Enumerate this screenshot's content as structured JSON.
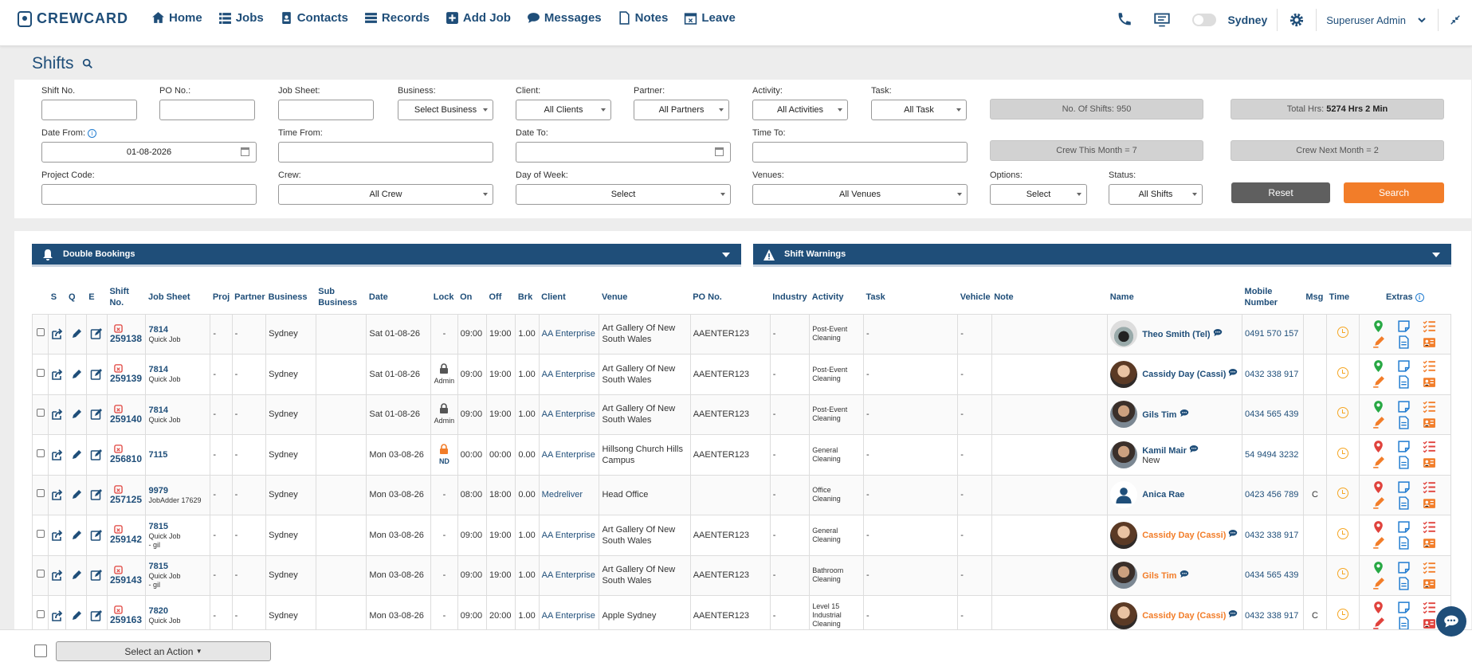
{
  "brand": {
    "name": "CREWCARD"
  },
  "nav": {
    "items": [
      {
        "label": "Home",
        "icon": "home-icon"
      },
      {
        "label": "Jobs",
        "icon": "list-icon"
      },
      {
        "label": "Contacts",
        "icon": "contact-icon"
      },
      {
        "label": "Records",
        "icon": "records-icon"
      },
      {
        "label": "Add Job",
        "icon": "plus-square-icon"
      },
      {
        "label": "Messages",
        "icon": "chat-icon"
      },
      {
        "label": "Notes",
        "icon": "note-icon"
      },
      {
        "label": "Leave",
        "icon": "calendar-icon"
      }
    ],
    "city": "Sydney",
    "user": "Superuser Admin"
  },
  "page": {
    "title": "Shifts"
  },
  "filters": {
    "shift_no": {
      "label": "Shift No.",
      "value": ""
    },
    "po_no": {
      "label": "PO No.:",
      "value": ""
    },
    "job_sheet": {
      "label": "Job Sheet:",
      "value": ""
    },
    "business": {
      "label": "Business:",
      "value": "Select Business"
    },
    "client": {
      "label": "Client:",
      "value": "All Clients"
    },
    "partner": {
      "label": "Partner:",
      "value": "All Partners"
    },
    "activity": {
      "label": "Activity:",
      "value": "All Activities"
    },
    "task": {
      "label": "Task:",
      "value": "All Task"
    },
    "no_of_shifts": "No. Of Shifts: 950",
    "total_hrs_label": "Total Hrs:",
    "total_hrs_value": "5274 Hrs  2 Min",
    "date_from": {
      "label": "Date From:",
      "value": "01-08-2026"
    },
    "time_from": {
      "label": "Time From:",
      "value": ""
    },
    "date_to": {
      "label": "Date To:",
      "value": ""
    },
    "time_to": {
      "label": "Time To:",
      "value": ""
    },
    "crew_this_month": "Crew This Month = 7",
    "crew_next_month": "Crew Next Month = 2",
    "project_code": {
      "label": "Project Code:",
      "value": ""
    },
    "crew": {
      "label": "Crew:",
      "value": "All Crew"
    },
    "day_of_week": {
      "label": "Day of Week:",
      "value": "Select"
    },
    "venues": {
      "label": "Venues:",
      "value": "All Venues"
    },
    "options": {
      "label": "Options:",
      "value": "Select"
    },
    "status": {
      "label": "Status:",
      "value": "All Shifts"
    },
    "reset_label": "Reset",
    "search_label": "Search"
  },
  "panels": {
    "double_bookings": "Double Bookings",
    "shift_warnings": "Shift Warnings"
  },
  "table": {
    "headers": {
      "s": "S",
      "q": "Q",
      "e": "E",
      "shift_no": "Shift No.",
      "job_sheet": "Job Sheet",
      "proj": "Proj",
      "partner": "Partner",
      "business": "Business",
      "sub_business": "Sub Business",
      "date": "Date",
      "lock": "Lock",
      "on": "On",
      "off": "Off",
      "brk": "Brk",
      "client": "Client",
      "venue": "Venue",
      "po_no": "PO No.",
      "industry": "Industry",
      "activity": "Activity",
      "task": "Task",
      "vehicle": "Vehicle",
      "note": "Note",
      "name": "Name",
      "mobile": "Mobile Number",
      "msg": "Msg",
      "time": "Time",
      "extras": "Extras"
    },
    "rows": [
      {
        "shift": "259138",
        "job": "7814",
        "job_sub": "Quick Job",
        "job_sub2": "",
        "proj": "-",
        "partner": "-",
        "business": "Sydney",
        "date": "Sat 01-08-26",
        "lock": "-",
        "lock_sub": "",
        "on": "09:00",
        "off": "19:00",
        "brk": "1.00",
        "client": "AA Enterprise",
        "venue": "Art Gallery Of New South Wales",
        "po": "AAENTER123",
        "industry": "-",
        "activity": "Post-Event Cleaning",
        "task": "-",
        "vehicle": "-",
        "name": "Theo Smith (Tel)",
        "name_sub": "",
        "mobile": "0491 570 157",
        "msg": ""
      },
      {
        "shift": "259139",
        "job": "7814",
        "job_sub": "Quick Job",
        "job_sub2": "",
        "proj": "-",
        "partner": "-",
        "business": "Sydney",
        "date": "Sat 01-08-26",
        "lock": "lock",
        "lock_sub": "Admin",
        "on": "09:00",
        "off": "19:00",
        "brk": "1.00",
        "client": "AA Enterprise",
        "venue": "Art Gallery Of New South Wales",
        "po": "AAENTER123",
        "industry": "-",
        "activity": "Post-Event Cleaning",
        "task": "-",
        "vehicle": "-",
        "name": "Cassidy Day (Cassi)",
        "name_sub": "",
        "mobile": "0432 338 917",
        "msg": ""
      },
      {
        "shift": "259140",
        "job": "7814",
        "job_sub": "Quick Job",
        "job_sub2": "",
        "proj": "-",
        "partner": "-",
        "business": "Sydney",
        "date": "Sat 01-08-26",
        "lock": "lock",
        "lock_sub": "Admin",
        "on": "09:00",
        "off": "19:00",
        "brk": "1.00",
        "client": "AA Enterprise",
        "venue": "Art Gallery Of New South Wales",
        "po": "AAENTER123",
        "industry": "-",
        "activity": "Post-Event Cleaning",
        "task": "-",
        "vehicle": "-",
        "name": "Gils Tim",
        "name_sub": "",
        "mobile": "0434 565 439",
        "msg": ""
      },
      {
        "shift": "256810",
        "job": "7115",
        "job_sub": "",
        "job_sub2": "",
        "proj": "-",
        "partner": "-",
        "business": "Sydney",
        "date": "Mon 03-08-26",
        "lock": "lock-orange",
        "lock_sub": "ND",
        "on": "00:00",
        "off": "00:00",
        "brk": "0.00",
        "client": "AA Enterprise",
        "venue": "Hillsong Church Hills Campus",
        "po": "AAENTER123",
        "industry": "-",
        "activity": "General Cleaning",
        "task": "-",
        "vehicle": "-",
        "name": "Kamil Mair",
        "name_sub": "New",
        "mobile": "54 9494 3232",
        "msg": ""
      },
      {
        "shift": "257125",
        "job": "9979",
        "job_sub": "JobAdder 17629",
        "job_sub2": "",
        "proj": "-",
        "partner": "-",
        "business": "Sydney",
        "date": "Mon 03-08-26",
        "lock": "-",
        "lock_sub": "",
        "on": "08:00",
        "off": "18:00",
        "brk": "0.00",
        "client": "Medreliver",
        "venue": "Head Office",
        "po": "",
        "industry": "-",
        "activity": "Office Cleaning",
        "task": "-",
        "vehicle": "-",
        "name": "Anica Rae",
        "name_sub": "",
        "mobile": "0423 456 789",
        "msg": "C"
      },
      {
        "shift": "259142",
        "job": "7815",
        "job_sub": "Quick Job",
        "job_sub2": "- gil",
        "proj": "-",
        "partner": "-",
        "business": "Sydney",
        "date": "Mon 03-08-26",
        "lock": "-",
        "lock_sub": "",
        "on": "09:00",
        "off": "19:00",
        "brk": "1.00",
        "client": "AA Enterprise",
        "venue": "Art Gallery Of New South Wales",
        "po": "AAENTER123",
        "industry": "-",
        "activity": "General Cleaning",
        "task": "-",
        "vehicle": "-",
        "name": "Cassidy Day (Cassi)",
        "name_sub": "",
        "mobile": "0432 338 917",
        "msg": ""
      },
      {
        "shift": "259143",
        "job": "7815",
        "job_sub": "Quick Job",
        "job_sub2": "- gil",
        "proj": "-",
        "partner": "-",
        "business": "Sydney",
        "date": "Mon 03-08-26",
        "lock": "-",
        "lock_sub": "",
        "on": "09:00",
        "off": "19:00",
        "brk": "1.00",
        "client": "AA Enterprise",
        "venue": "Art Gallery Of New South Wales",
        "po": "AAENTER123",
        "industry": "-",
        "activity": "Bathroom Cleaning",
        "task": "-",
        "vehicle": "-",
        "name": "Gils Tim",
        "name_sub": "",
        "mobile": "0434 565 439",
        "msg": ""
      },
      {
        "shift": "259163",
        "job": "7820",
        "job_sub": "Quick Job",
        "job_sub2": "",
        "proj": "-",
        "partner": "-",
        "business": "Sydney",
        "date": "Mon 03-08-26",
        "lock": "-",
        "lock_sub": "",
        "on": "09:00",
        "off": "20:00",
        "brk": "1.00",
        "client": "AA Enterprise",
        "venue": "Apple Sydney",
        "po": "AAENTER123",
        "industry": "-",
        "activity": "Level 15 Industrial Cleaning",
        "task": "-",
        "vehicle": "-",
        "name": "Cassidy Day (Cassi)",
        "name_sub": "",
        "mobile": "0432 338 917",
        "msg": "C"
      }
    ]
  },
  "bottom": {
    "action_label": "Select an Action"
  },
  "colors": {
    "primary": "#1f4e79",
    "accent": "#f27d29",
    "danger": "#e0423c",
    "success": "#27a844"
  }
}
